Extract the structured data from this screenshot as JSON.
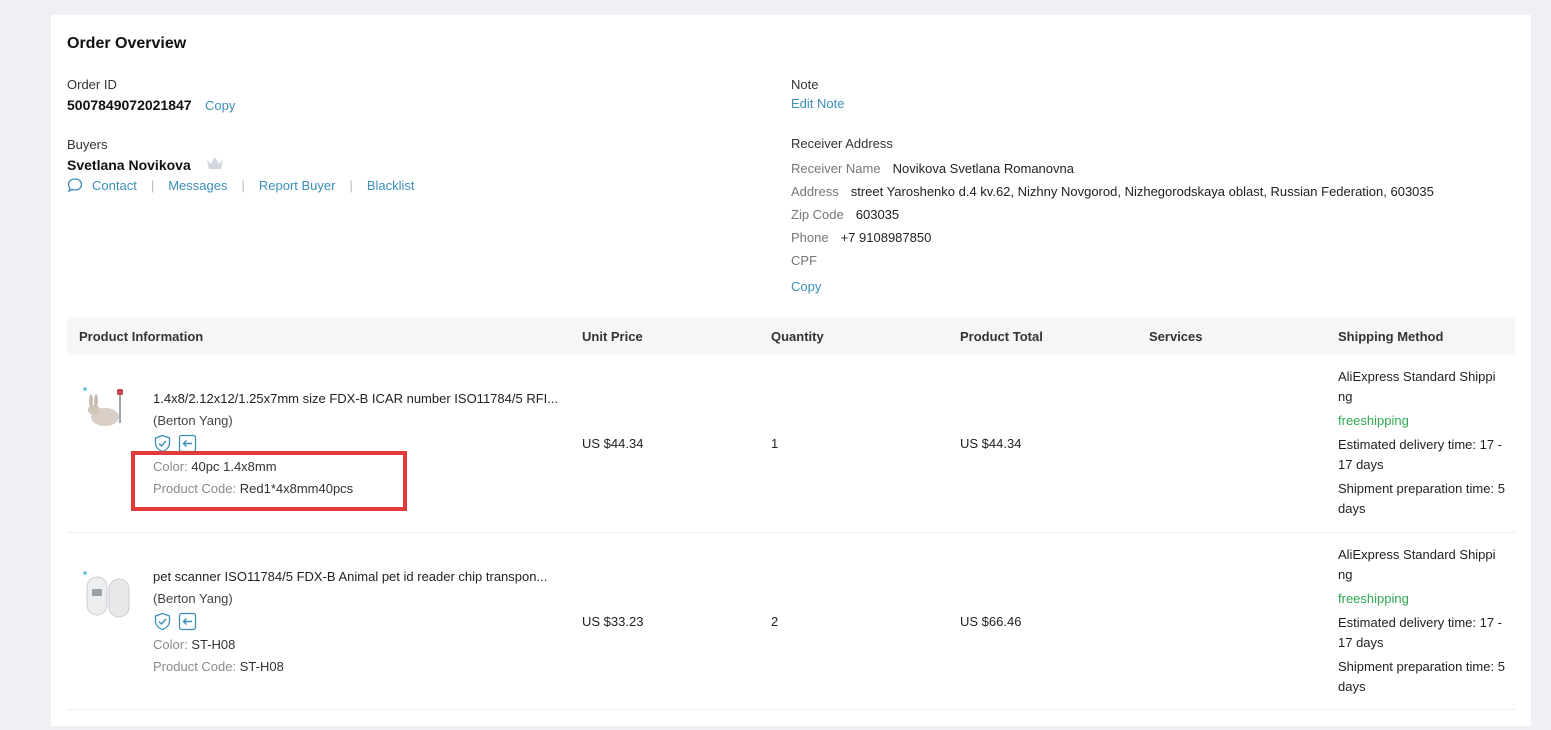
{
  "overview": {
    "title": "Order Overview"
  },
  "order": {
    "id_label": "Order ID",
    "id": "5007849072021847",
    "copy_label": "Copy"
  },
  "buyer": {
    "label": "Buyers",
    "name": "Svetlana Novikova",
    "actions": [
      "Contact",
      "Messages",
      "Report Buyer",
      "Blacklist"
    ]
  },
  "note": {
    "label": "Note",
    "edit_label": "Edit Note"
  },
  "receiver": {
    "label": "Receiver Address",
    "name_key": "Receiver Name",
    "name": "Novikova Svetlana Romanovna",
    "address_key": "Address",
    "address": "street Yaroshenko d.4 kv.62, Nizhny Novgorod, Nizhegorodskaya oblast, Russian Federation, 603035",
    "zip_key": "Zip Code",
    "zip": "603035",
    "phone_key": "Phone",
    "phone": "+7 9108987850",
    "cpf_key": "CPF",
    "copy_label": "Copy"
  },
  "table": {
    "headers": [
      "Product Information",
      "Unit Price",
      "Quantity",
      "Product Total",
      "Services",
      "Shipping Method"
    ],
    "rows": [
      {
        "name": "1.4x8/2.12x12/1.25x7mm size FDX-B ICAR number ISO11784/5 RFI...",
        "seller": "(Berton Yang)",
        "color_key": "Color:",
        "color": "40pc 1.4x8mm",
        "code_key": "Product Code:",
        "code": "Red1*4x8mm40pcs",
        "unit_price": "US $44.34",
        "quantity": "1",
        "total": "US $44.34",
        "ship_method": "AliExpress Standard Shippi ng",
        "ship_free": "freeshipping",
        "ship_delivery": "Estimated delivery time: 17 - 17 days",
        "ship_prep": "Shipment preparation time: 5 days"
      },
      {
        "name": "pet scanner ISO11784/5 FDX-B Animal pet id reader chip transpon...",
        "seller": "(Berton Yang)",
        "color_key": "Color:",
        "color": "ST-H08",
        "code_key": "Product Code:",
        "code": "ST-H08",
        "unit_price": "US $33.23",
        "quantity": "2",
        "total": "US $66.46",
        "ship_method": "AliExpress Standard Shippi ng",
        "ship_free": "freeshipping",
        "ship_delivery": "Estimated delivery time: 17 - 17 days",
        "ship_prep": "Shipment preparation time: 5 days"
      }
    ]
  },
  "colors": {
    "link": "#3b8fb8",
    "free": "#2ea84f",
    "highlight": "#e03a3a"
  }
}
